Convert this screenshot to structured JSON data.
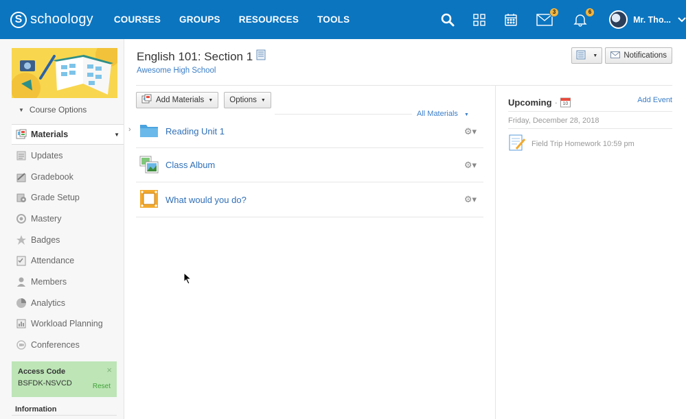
{
  "nav": {
    "logo_letter": "S",
    "logo_text": "schoology",
    "links": [
      "COURSES",
      "GROUPS",
      "RESOURCES",
      "TOOLS"
    ],
    "messages_badge": "3",
    "notifications_badge": "6",
    "user_name": "Mr. Tho..."
  },
  "sidebar": {
    "course_options": "Course Options",
    "items": [
      {
        "label": "Materials",
        "icon": "materials-icon"
      },
      {
        "label": "Updates",
        "icon": "updates-icon"
      },
      {
        "label": "Gradebook",
        "icon": "gradebook-icon"
      },
      {
        "label": "Grade Setup",
        "icon": "grade-setup-icon"
      },
      {
        "label": "Mastery",
        "icon": "mastery-icon"
      },
      {
        "label": "Badges",
        "icon": "badges-icon"
      },
      {
        "label": "Attendance",
        "icon": "attendance-icon"
      },
      {
        "label": "Members",
        "icon": "members-icon"
      },
      {
        "label": "Analytics",
        "icon": "analytics-icon"
      },
      {
        "label": "Workload Planning",
        "icon": "workload-icon"
      },
      {
        "label": "Conferences",
        "icon": "conferences-icon"
      }
    ],
    "access_code": {
      "title": "Access Code",
      "code": "BSFDK-NSVCD",
      "reset": "Reset",
      "close": "×"
    },
    "information": "Information"
  },
  "main": {
    "course_title": "English 101: Section 1",
    "school": "Awesome High School",
    "notifications_btn": "Notifications",
    "add_materials": "Add Materials",
    "options": "Options",
    "all_materials": "All Materials",
    "materials": [
      {
        "title": "Reading Unit 1",
        "type": "folder"
      },
      {
        "title": "Class Album",
        "type": "album"
      },
      {
        "title": "What would you do?",
        "type": "discussion"
      }
    ]
  },
  "upcoming": {
    "title": "Upcoming",
    "separator": "·",
    "calendar_day": "10",
    "add_event": "Add Event",
    "date": "Friday, December 28, 2018",
    "event": "Field Trip Homework 10:59 pm"
  },
  "colors": {
    "nav_bg": "#0b75c0",
    "link": "#2f6fb7",
    "access_bg": "#bde5b6",
    "badge": "#f3b43c"
  }
}
